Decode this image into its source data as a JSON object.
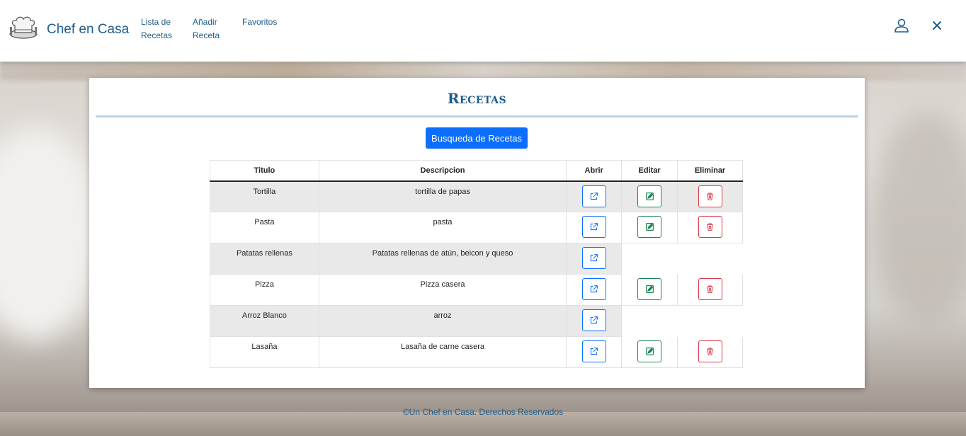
{
  "header": {
    "brand": "Chef en Casa",
    "nav": [
      {
        "label": "Lista de Recetas",
        "line1": "Lista de",
        "line2": "Recetas"
      },
      {
        "label": "Añadir Receta",
        "line1": "Añadir",
        "line2": "Receta"
      },
      {
        "label": "Favoritos",
        "line1": "Favoritos",
        "line2": ""
      }
    ],
    "icons": {
      "user": "user-icon",
      "close": "close-icon",
      "logo": "chef-hat-logo-icon"
    }
  },
  "main": {
    "title": "Recetas",
    "search_button": "Busqueda de Recetas",
    "table": {
      "columns": [
        "Titulo",
        "Descripcion",
        "Abrir",
        "Editar",
        "Eliminar"
      ],
      "rows": [
        {
          "titulo": "Tortilla",
          "descripcion": "tortilla de papas",
          "abrir": true,
          "editar": true,
          "eliminar": true
        },
        {
          "titulo": "Pasta",
          "descripcion": "pasta",
          "abrir": true,
          "editar": true,
          "eliminar": true
        },
        {
          "titulo": "Patatas rellenas",
          "descripcion": "Patatas rellenas de atún, beicon y queso",
          "abrir": true,
          "editar": false,
          "eliminar": false
        },
        {
          "titulo": "Pizza",
          "descripcion": "Pizza casera",
          "abrir": true,
          "editar": true,
          "eliminar": true
        },
        {
          "titulo": "Arroz Blanco",
          "descripcion": "arroz",
          "abrir": true,
          "editar": false,
          "eliminar": false
        },
        {
          "titulo": "Lasaña",
          "descripcion": "Lasaña de carne casera",
          "abrir": true,
          "editar": true,
          "eliminar": true
        }
      ]
    },
    "action_icons": {
      "abrir": "external-link-icon",
      "editar": "pencil-square-icon",
      "eliminar": "trash-icon"
    }
  },
  "footer": {
    "text": "©Un Chef en Casa. Derechos Reservados"
  },
  "colors": {
    "brand": "#1f5d8c",
    "primary": "#0d6efd",
    "success": "#198754",
    "danger": "#dc3545",
    "rule": "#bcd3e3"
  }
}
